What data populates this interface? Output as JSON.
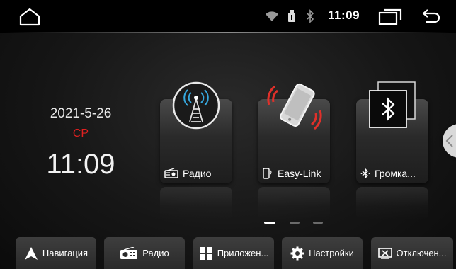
{
  "status_bar": {
    "time": "11:09",
    "icons": [
      "home-icon",
      "wifi-icon",
      "usb-icon",
      "bluetooth-icon",
      "recent-apps-icon",
      "back-icon"
    ]
  },
  "clock_widget": {
    "date": "2021-5-26",
    "weekday": "СР",
    "time": "11:09",
    "weekday_color": "#e02020"
  },
  "apps": [
    {
      "label": "Радио",
      "icon": "radio-tower-icon",
      "small_icon": "radio-icon"
    },
    {
      "label": "Easy-Link",
      "icon": "phone-link-icon",
      "small_icon": "phone-icon"
    },
    {
      "label": "Громка...",
      "icon": "bluetooth-icon",
      "small_icon": "bluetooth-small-icon"
    }
  ],
  "pager": {
    "pages": 3,
    "active": 1
  },
  "dock": [
    {
      "label": "Навигация",
      "icon": "navigation-arrow-icon"
    },
    {
      "label": "Радио",
      "icon": "radio-icon"
    },
    {
      "label": "Приложен...",
      "icon": "apps-grid-icon"
    },
    {
      "label": "Настройки",
      "icon": "gear-icon"
    },
    {
      "label": "Отключен...",
      "icon": "screen-off-icon"
    }
  ]
}
